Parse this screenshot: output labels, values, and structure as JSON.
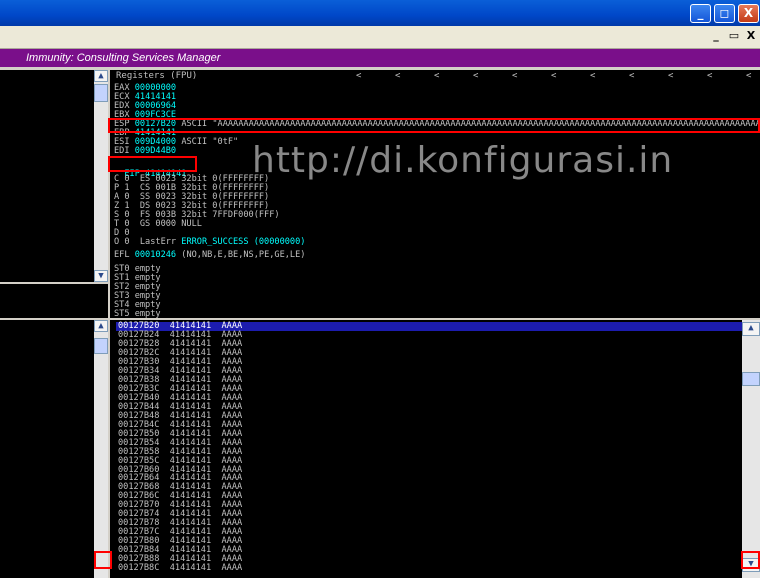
{
  "window": {
    "min_label": "_",
    "max_label": "◻",
    "close_label": "X"
  },
  "mdi": {
    "min_label": "_",
    "restore_label": "▭",
    "close_label": "X"
  },
  "app": {
    "title": "Immunity: Consulting Services Manager"
  },
  "registers": {
    "header": "Registers (FPU)",
    "header_arrows": [
      "<",
      "<",
      "<",
      "<",
      "<",
      "<",
      "<",
      "<",
      "<",
      "<",
      "<"
    ],
    "lines": [
      {
        "name": "EAX",
        "value": "00000000",
        "extra": ""
      },
      {
        "name": "ECX",
        "value": "41414141",
        "extra": ""
      },
      {
        "name": "EDX",
        "value": "00006964",
        "extra": ""
      },
      {
        "name": "EBX",
        "value": "009FC3CE",
        "extra": ""
      },
      {
        "name": "ESP",
        "value": "00127B20",
        "extra": "ASCII \"AAAAAAAAAAAAAAAAAAAAAAAAAAAAAAAAAAAAAAAAAAAAAAAAAAAAAAAAAAAAAAAAAAAAAAAAAAAAAAAAAAAAAAAAAAAAAAAAAAAAAAAAAAAA"
      },
      {
        "name": "EBP",
        "value": "41414141",
        "extra": ""
      },
      {
        "name": "ESI",
        "value": "009D4000",
        "extra": "ASCII \"0tF\""
      },
      {
        "name": "EDI",
        "value": "009D44B0",
        "extra": ""
      }
    ],
    "eip": "EIP 41414141",
    "flags": [
      "C 0  ES 0023 32bit 0(FFFFFFFF)",
      "P 1  CS 001B 32bit 0(FFFFFFFF)",
      "A 0  SS 0023 32bit 0(FFFFFFFF)",
      "Z 1  DS 0023 32bit 0(FFFFFFFF)",
      "S 0  FS 003B 32bit 7FFDF000(FFF)",
      "T 0  GS 0000 NULL",
      "D 0"
    ],
    "lasterr_prefix": "O 0  LastErr ",
    "lasterr_value": "ERROR_SUCCESS (00000000)",
    "efl_label": "EFL ",
    "efl_value": "00010246",
    "efl_desc": " (NO,NB,E,BE,NS,PE,GE,LE)",
    "fpu": [
      "ST0 empty",
      "ST1 empty",
      "ST2 empty",
      "ST3 empty",
      "ST4 empty",
      "ST5 empty"
    ]
  },
  "watermark": "http://di.konfigurasi.in",
  "stack": {
    "rows": [
      "00127B20  41414141  AAAA",
      "00127B24  41414141  AAAA",
      "00127B28  41414141  AAAA",
      "00127B2C  41414141  AAAA",
      "00127B30  41414141  AAAA",
      "00127B34  41414141  AAAA",
      "00127B38  41414141  AAAA",
      "00127B3C  41414141  AAAA",
      "00127B40  41414141  AAAA",
      "00127B44  41414141  AAAA",
      "00127B48  41414141  AAAA",
      "00127B4C  41414141  AAAA",
      "00127B50  41414141  AAAA",
      "00127B54  41414141  AAAA",
      "00127B58  41414141  AAAA",
      "00127B5C  41414141  AAAA",
      "00127B60  41414141  AAAA",
      "00127B64  41414141  AAAA",
      "00127B68  41414141  AAAA",
      "00127B6C  41414141  AAAA",
      "00127B70  41414141  AAAA",
      "00127B74  41414141  AAAA",
      "00127B78  41414141  AAAA",
      "00127B7C  41414141  AAAA",
      "00127B80  41414141  AAAA",
      "00127B84  41414141  AAAA",
      "00127B88  41414141  AAAA",
      "00127B8C  41414141  AAAA"
    ]
  },
  "colors": {
    "app_bar": "#7a0f8a",
    "highlight_red": "#ff0000",
    "selection": "#1c1cae",
    "cyan_value": "#00ffff"
  }
}
